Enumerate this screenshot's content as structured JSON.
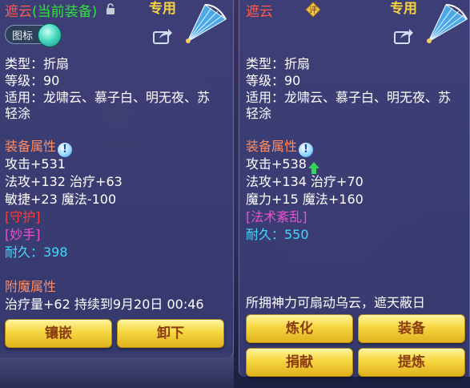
{
  "left": {
    "title": "遮云",
    "title_note": "(当前装备)",
    "exclusive": "专用",
    "icon_toggle_label": "图标",
    "type": "类型：折扇",
    "level": "等级：90",
    "fit_line1": "适用：龙啸云、慕子白、明无夜、苏",
    "fit_line2": "轻涂",
    "attr_heading": "装备属性",
    "attr_line1": "攻击+531",
    "attr_line2": "法攻+132 治疗+63",
    "attr_line3": "敏捷+23 魔法-100",
    "skill1": "[守护]",
    "skill2": "[妙手]",
    "durability": "耐久：398",
    "enchant_heading": "附魔属性",
    "enchant_line": "治疗量+62 持续到9月20日 00:46",
    "buttons": [
      "镶嵌",
      "卸下"
    ]
  },
  "right": {
    "title": "遮云",
    "rating_badge": "评",
    "exclusive": "专用",
    "type": "类型：折扇",
    "level": "等级：90",
    "fit_line1": "适用：龙啸云、慕子白、明无夜、苏",
    "fit_line2": "轻涂",
    "attr_heading": "装备属性",
    "attr_line1": "攻击+538",
    "attr_line2": "法攻+134 治疗+70",
    "attr_line3": "魔力+15 魔法+160",
    "skill1": "[法术紊乱]",
    "durability": "耐久：550",
    "description": "所拥神力可扇动乌云，遮天蔽日",
    "buttons": [
      "炼化",
      "装备",
      "捐献",
      "提炼"
    ]
  },
  "colors": {
    "title_red": "#ff5a4e",
    "green_note": "#2fe33a",
    "exclusive_gold": "#f6d33e",
    "heading_orange": "#ff8b62",
    "skill_pink": "#f04fd0",
    "skill_red": "#ff3a3a",
    "durability_cyan": "#41d8ff",
    "button_gold": "#f5d640"
  }
}
